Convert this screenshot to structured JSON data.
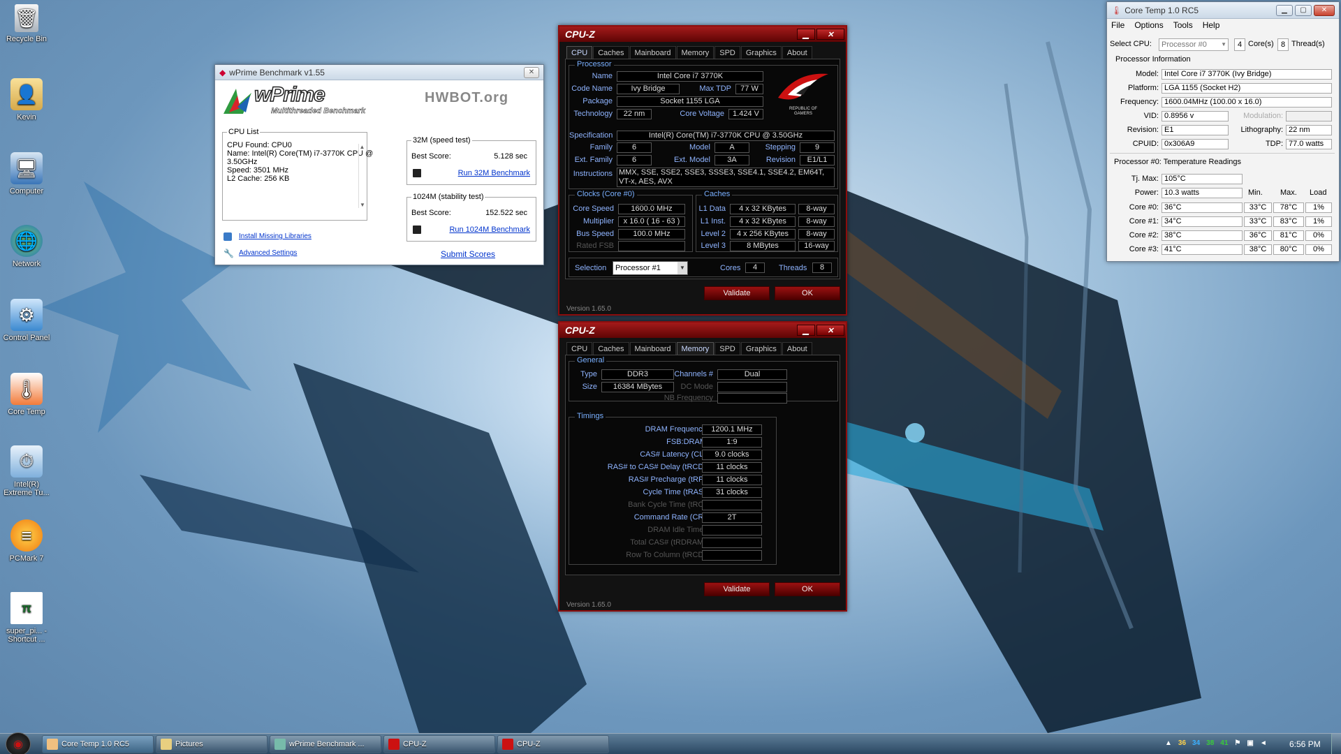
{
  "desktop": {
    "icons": [
      {
        "label": "Recycle Bin"
      },
      {
        "label": "Kevin"
      },
      {
        "label": "Computer"
      },
      {
        "label": "Network"
      },
      {
        "label": "Control Panel"
      },
      {
        "label": "Core Temp"
      },
      {
        "label": "Intel(R) Extreme Tu..."
      },
      {
        "label": "PCMark 7"
      },
      {
        "label": "super_pi... - Shortcut ..."
      }
    ]
  },
  "wprime": {
    "title": "wPrime Benchmark v1.55",
    "logo": "wPrime",
    "logo_sub": "Multithreaded Benchmark",
    "hwbot": "HWBOT.org",
    "cpu_list": {
      "label": "CPU List",
      "lines": [
        "CPU Found: CPU0",
        "Name:   Intel(R) Core(TM) i7-3770K CPU @",
        "3.50GHz",
        "Speed:   3501 MHz",
        "L2 Cache: 256 KB"
      ]
    },
    "test32": {
      "label": "32M (speed test)",
      "best_label": "Best Score:",
      "score": "5.128 sec",
      "run": "Run 32M Benchmark"
    },
    "test1024": {
      "label": "1024M (stability test)",
      "best_label": "Best Score:",
      "score": "152.522 sec",
      "run": "Run 1024M Benchmark"
    },
    "install": "Install Missing Libraries",
    "advanced": "Advanced Settings",
    "submit": "Submit Scores"
  },
  "cpuz_tabs": [
    "CPU",
    "Caches",
    "Mainboard",
    "Memory",
    "SPD",
    "Graphics",
    "About"
  ],
  "cpuz1": {
    "title": "CPU-Z",
    "processor": {
      "label": "Processor",
      "name_l": "Name",
      "name": "Intel Core i7 3770K",
      "code_l": "Code Name",
      "code": "Ivy Bridge",
      "tdp_l": "Max TDP",
      "tdp": "77 W",
      "pkg_l": "Package",
      "pkg": "Socket 1155 LGA",
      "tech_l": "Technology",
      "tech": "22 nm",
      "volt_l": "Core Voltage",
      "volt": "1.424 V",
      "spec_l": "Specification",
      "spec": "Intel(R) Core(TM) i7-3770K CPU @ 3.50GHz",
      "fam_l": "Family",
      "fam": "6",
      "model_l": "Model",
      "model": "A",
      "step_l": "Stepping",
      "step": "9",
      "efam_l": "Ext. Family",
      "efam": "6",
      "emodel_l": "Ext. Model",
      "emodel": "3A",
      "rev_l": "Revision",
      "rev": "E1/L1",
      "inst_l": "Instructions",
      "inst1": "MMX, SSE, SSE2, SSE3, SSSE3, SSE4.1, SSE4.2, EM64T,",
      "inst2": "VT-x, AES, AVX"
    },
    "rog": "REPUBLIC OF GAMERS",
    "clocks": {
      "label": "Clocks (Core #0)",
      "cs_l": "Core Speed",
      "cs": "1600.0 MHz",
      "mult_l": "Multiplier",
      "mult": "x 16.0 ( 16 - 63 )",
      "bus_l": "Bus Speed",
      "bus": "100.0 MHz",
      "fsb_l": "Rated FSB"
    },
    "caches": {
      "label": "Caches",
      "rows": [
        {
          "l": "L1 Data",
          "v": "4 x 32 KBytes",
          "w": "8-way"
        },
        {
          "l": "L1 Inst.",
          "v": "4 x 32 KBytes",
          "w": "8-way"
        },
        {
          "l": "Level 2",
          "v": "4 x 256 KBytes",
          "w": "8-way"
        },
        {
          "l": "Level 3",
          "v": "8 MBytes",
          "w": "16-way"
        }
      ]
    },
    "sel_l": "Selection",
    "sel": "Processor #1",
    "cores_l": "Cores",
    "cores": "4",
    "threads_l": "Threads",
    "threads": "8",
    "validate": "Validate",
    "ok": "OK",
    "version": "Version 1.65.0"
  },
  "cpuz2": {
    "title": "CPU-Z",
    "general": {
      "label": "General",
      "type_l": "Type",
      "type": "DDR3",
      "size_l": "Size",
      "size": "16384 MBytes",
      "ch_l": "Channels #",
      "ch": "Dual",
      "dc_l": "DC Mode",
      "nb_l": "NB Frequency"
    },
    "timings": {
      "label": "Timings",
      "rows": [
        {
          "l": "DRAM Frequency",
          "v": "1200.1 MHz"
        },
        {
          "l": "FSB:DRAM",
          "v": "1:9"
        },
        {
          "l": "CAS# Latency (CL)",
          "v": "9.0 clocks"
        },
        {
          "l": "RAS# to CAS# Delay (tRCD)",
          "v": "11 clocks"
        },
        {
          "l": "RAS# Precharge (tRP)",
          "v": "11 clocks"
        },
        {
          "l": "Cycle Time (tRAS)",
          "v": "31 clocks"
        },
        {
          "l": "Bank Cycle Time (tRC)",
          "v": ""
        },
        {
          "l": "Command Rate (CR)",
          "v": "2T"
        },
        {
          "l": "DRAM Idle Timer",
          "v": ""
        },
        {
          "l": "Total CAS# (tRDRAM)",
          "v": ""
        },
        {
          "l": "Row To Column (tRCD)",
          "v": ""
        }
      ]
    },
    "validate": "Validate",
    "ok": "OK",
    "version": "Version 1.65.0"
  },
  "coretemp": {
    "title": "Core Temp 1.0 RC5",
    "menu": [
      "File",
      "Options",
      "Tools",
      "Help"
    ],
    "sel_l": "Select CPU:",
    "sel": "Processor #0",
    "cores": "4",
    "cores_l": "Core(s)",
    "threads": "8",
    "threads_l": "Thread(s)",
    "info_l": "Processor Information",
    "model_l": "Model:",
    "model": "Intel Core i7 3770K (Ivy Bridge)",
    "plat_l": "Platform:",
    "plat": "LGA 1155 (Socket H2)",
    "freq_l": "Frequency:",
    "freq": "1600.04MHz (100.00 x 16.0)",
    "vid_l": "VID:",
    "vid": "0.8956 v",
    "mod_l": "Modulation:",
    "rev_l": "Revision:",
    "rev": "E1",
    "lith_l": "Lithography:",
    "lith": "22 nm",
    "cpuid_l": "CPUID:",
    "cpuid": "0x306A9",
    "tdp_l": "TDP:",
    "tdp": "77.0 watts",
    "temp_l": "Processor #0: Temperature Readings",
    "tj_l": "Tj. Max:",
    "tj": "105°C",
    "pow_l": "Power:",
    "pow": "10.3 watts",
    "h_min": "Min.",
    "h_max": "Max.",
    "h_load": "Load",
    "cores_rows": [
      {
        "l": "Core #0:",
        "t": "36°C",
        "min": "33°C",
        "max": "78°C",
        "load": "1%"
      },
      {
        "l": "Core #1:",
        "t": "34°C",
        "min": "33°C",
        "max": "83°C",
        "load": "1%"
      },
      {
        "l": "Core #2:",
        "t": "38°C",
        "min": "36°C",
        "max": "81°C",
        "load": "0%"
      },
      {
        "l": "Core #3:",
        "t": "41°C",
        "min": "38°C",
        "max": "80°C",
        "load": "0%"
      }
    ]
  },
  "taskbar": {
    "items": [
      "Core Temp 1.0 RC5",
      "Pictures",
      "wPrime Benchmark ...",
      "CPU-Z",
      "CPU-Z"
    ],
    "tray_temps": [
      "36",
      "34",
      "38",
      "41"
    ],
    "clock": "6:56 PM"
  }
}
